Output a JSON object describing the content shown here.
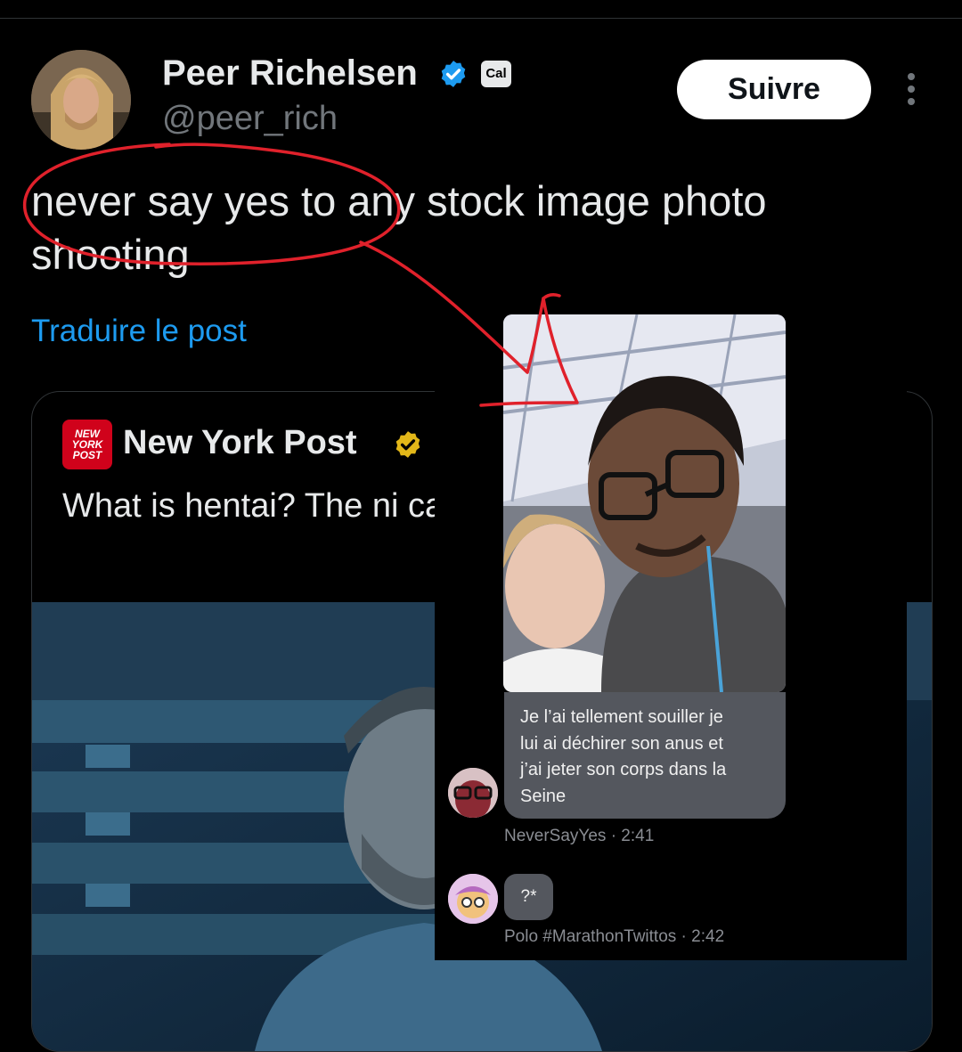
{
  "author": {
    "name": "Peer Richelsen",
    "handle": "@peer_rich",
    "affiliate_badge": "Cal",
    "follow_label": "Suivre"
  },
  "tweet": {
    "text": "never say yes to any stock image photo shooting",
    "translate_label": "Traduire le post"
  },
  "quoted": {
    "logo_text": "NEW YORK POST",
    "name": "New York Post",
    "text": "What is hentai? The ni can't stop watching tri"
  },
  "overlay": {
    "message": {
      "lines": [
        "Je l’ai tellement souiller je",
        "lui ai déchirer son anus et",
        "j’ai jeter son corps dans la",
        "Seine"
      ],
      "meta": "NeverSayYes · 2:41"
    },
    "reply": {
      "text": "?*",
      "meta": "Polo #MarathonTwittos · 2:42"
    }
  },
  "colors": {
    "background": "#000000",
    "link": "#1d9bf0",
    "verified_blue": "#1d9bf0",
    "verified_gold": "#e2b719",
    "annotation_red": "#e0212b",
    "nyp_red": "#d0021b"
  },
  "icons": [
    "verified-badge-icon",
    "more-options-icon",
    "gold-verified-badge-icon"
  ]
}
